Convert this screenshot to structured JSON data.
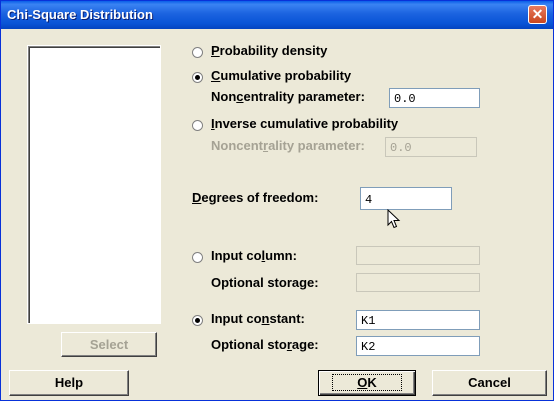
{
  "window": {
    "title": "Chi-Square Distribution",
    "close_glyph": "✕"
  },
  "options": {
    "probability_density": {
      "pre": "",
      "key": "P",
      "post": "robability density"
    },
    "cumulative_probability": {
      "pre": "",
      "key": "C",
      "post": "umulative probability"
    },
    "noncentrality_label": {
      "pre": "Non",
      "key": "c",
      "post": "entrality parameter:"
    },
    "noncentrality_value": "0.0",
    "inverse_cumulative": {
      "pre": "",
      "key": "I",
      "post": "nverse cumulative probability"
    },
    "inverse_noncentrality_label": {
      "pre": "Noncent",
      "key": "r",
      "post": "ality parameter:"
    },
    "inverse_noncentrality_value": "0.0",
    "selected": "cumulative_probability"
  },
  "degrees": {
    "label": {
      "pre": "",
      "key": "D",
      "post": "egrees of freedom:"
    },
    "value": "4"
  },
  "input_column": {
    "label": {
      "pre": "Input co",
      "key": "l",
      "post": "umn:"
    },
    "value": "",
    "optional_label": "Optional storage:",
    "optional_value": ""
  },
  "input_constant": {
    "label": {
      "pre": "Input co",
      "key": "n",
      "post": "stant:"
    },
    "value": "K1",
    "optional_label": {
      "pre": "Optional sto",
      "key": "r",
      "post": "age:"
    },
    "optional_value": "K2",
    "selected": true
  },
  "buttons": {
    "select": "Select",
    "help": "Help",
    "ok": {
      "pre": "",
      "key": "O",
      "post": "K"
    },
    "cancel": "Cancel"
  }
}
